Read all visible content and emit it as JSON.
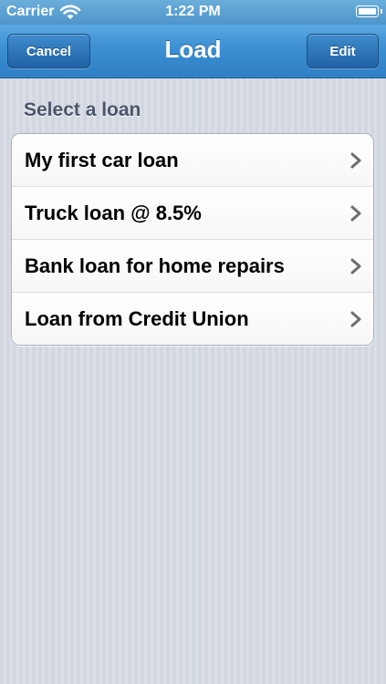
{
  "status_bar": {
    "carrier": "Carrier",
    "time": "1:22 PM"
  },
  "nav_bar": {
    "title": "Load",
    "left_button": "Cancel",
    "right_button": "Edit"
  },
  "section": {
    "header": "Select a loan"
  },
  "loans": [
    {
      "label": "My first car loan"
    },
    {
      "label": "Truck loan @ 8.5%"
    },
    {
      "label": "Bank loan for home repairs"
    },
    {
      "label": "Loan from Credit Union"
    }
  ],
  "icons": {
    "row_accessory": "chevron-right-icon",
    "network": "wifi-icon",
    "battery": "battery-icon"
  },
  "colors": {
    "nav_bar": "#3b8fd3",
    "button": "#1f62a5",
    "section_header": "#4c566a",
    "background": "#d5d9e2"
  }
}
